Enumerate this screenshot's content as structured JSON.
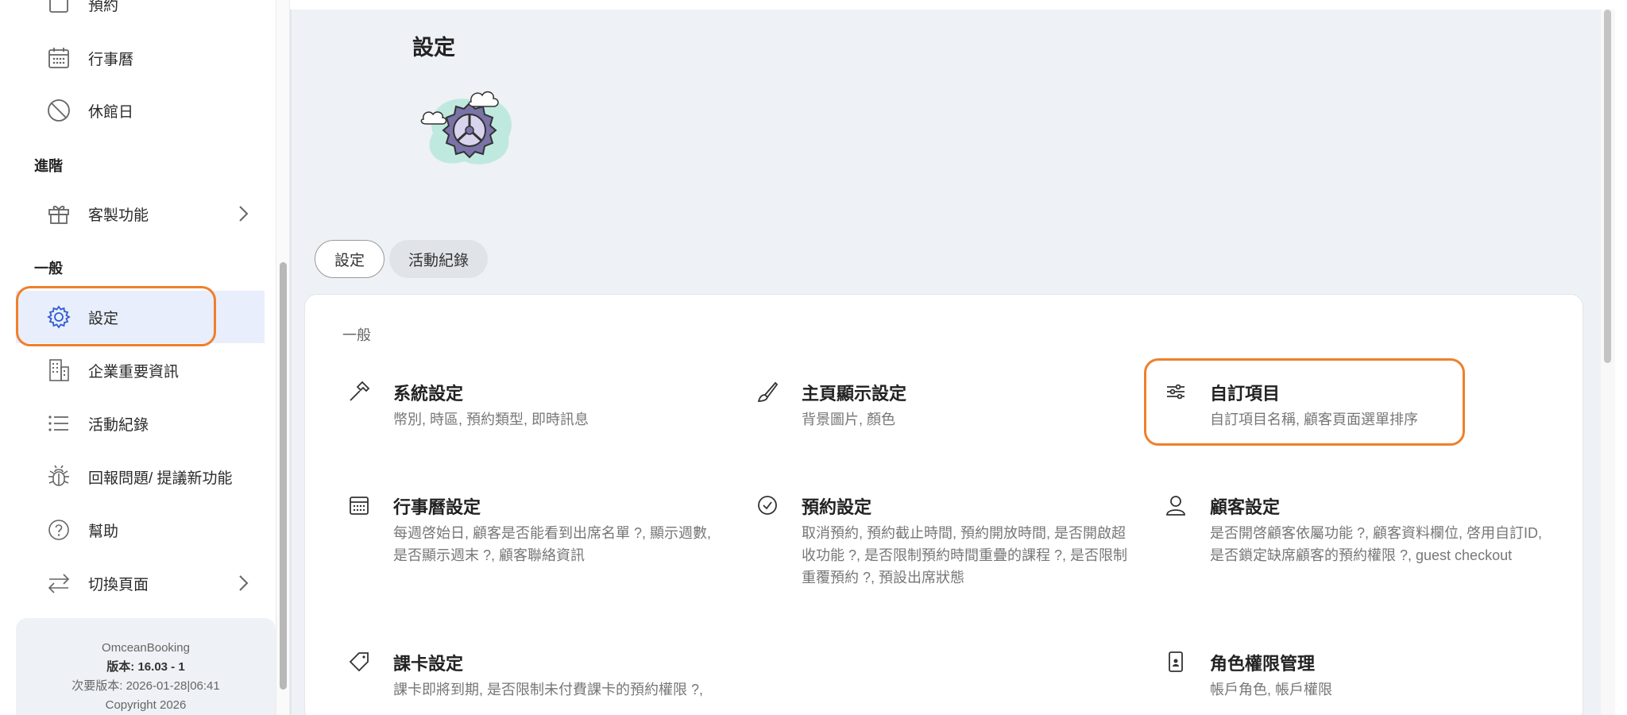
{
  "sidebar": {
    "items_top": [
      {
        "label": "預約",
        "icon": "calendar-icon"
      },
      {
        "label": "行事曆",
        "icon": "calendar-icon"
      },
      {
        "label": "休館日",
        "icon": "prohibited-icon"
      }
    ],
    "section_advanced": "進階",
    "custom_features": "客製功能",
    "section_general": "一般",
    "settings": "設定",
    "company_info": "企業重要資訊",
    "activity_log": "活動紀錄",
    "report_issue": "回報問題/ 提議新功能",
    "help": "幫助",
    "switch_page": "切換頁面",
    "footer": {
      "app_name": "OmceanBooking",
      "version_label": "版本:",
      "version_value": "16.03 - 1",
      "next_version": "次要版本: 2026-01-28|06:41",
      "copyright": "Copyright 2026"
    }
  },
  "main": {
    "title": "設定",
    "tabs": [
      {
        "label": "設定",
        "active": true
      },
      {
        "label": "活動紀錄",
        "active": false
      }
    ],
    "section_label": "一般",
    "items": [
      {
        "title": "系統設定",
        "desc": "幣別, 時區, 預約類型, 即時訊息",
        "icon": "hammer-icon"
      },
      {
        "title": "主頁顯示設定",
        "desc": "背景圖片, 顏色",
        "icon": "brush-icon"
      },
      {
        "title": "自訂項目",
        "desc": "自訂項目名稱, 顧客頁面選單排序",
        "icon": "sliders-icon"
      },
      {
        "title": "行事曆設定",
        "desc": "每週啓始日, 顧客是否能看到出席名單 ?, 顯示週數, 是否顯示週末 ?, 顧客聯絡資訊",
        "icon": "calendar-icon"
      },
      {
        "title": "預約設定",
        "desc": "取消預約, 預約截止時間, 預約開放時間, 是否開啟超收功能 ?, 是否限制預約時間重疊的課程 ?, 是否限制重覆預約 ?, 預設出席狀態",
        "icon": "check-circle-icon"
      },
      {
        "title": "顧客設定",
        "desc": "是否開啓顧客依屬功能 ?, 顧客資料欄位, 啓用自訂ID, 是否鎖定缺席顧客的預約權限 ?, guest checkout",
        "icon": "user-icon"
      },
      {
        "title": "課卡設定",
        "desc": "課卡即將到期, 是否限制未付費課卡的預約權限 ?,",
        "icon": "tag-icon"
      },
      {
        "title": "角色權限管理",
        "desc": "帳戶角色, 帳戶權限",
        "icon": "phone-user-icon"
      }
    ]
  },
  "colors": {
    "highlight": "#f07f2a",
    "active_bg": "#e8eefb",
    "active_icon": "#2f5bd3",
    "main_bg": "#eef1f5"
  }
}
